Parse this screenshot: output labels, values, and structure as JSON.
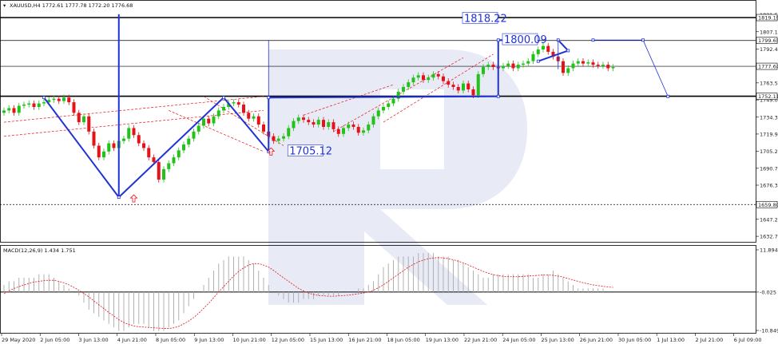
{
  "symbol_header": "XAUUSD,H4  1772.61 1777.78 1772.20 1776.68",
  "macd_header": "MACD(12,26,9) 1.434 1.751",
  "colors": {
    "background": "#ffffff",
    "bull_candle": "#22c21a",
    "bear_candle": "#e5121a",
    "level_line": "#000000",
    "pattern_line": "#1f33d6",
    "channel": "#e5121a",
    "macd_histogram": "#b0b0b0",
    "macd_signal": "#e5121a",
    "grid": "#c0c0c0",
    "watermark": "#e8ebf6"
  },
  "chart_data": {
    "type": "candlestick",
    "price_axis": {
      "ticks": [
        "1821.55",
        "1807.10",
        "1792.45",
        "1763.50",
        "1749.00",
        "1734.30",
        "1719.90",
        "1705.25",
        "1690.70",
        "1676.30",
        "1647.20",
        "1632.70"
      ],
      "highlighted_levels": [
        {
          "label": "1819.19",
          "value": 1819.19
        },
        {
          "label": "1799.65",
          "value": 1799.65
        },
        {
          "label": "1777.64",
          "value": 1777.64
        },
        {
          "label": "1752.11",
          "value": 1752.11
        },
        {
          "label": "1659.80",
          "value": 1659.8
        }
      ]
    },
    "time_axis": {
      "labels": [
        "29 May 2020",
        "2 Jun 05:00",
        "3 Jun 13:00",
        "4 Jun 21:00",
        "8 Jun 05:00",
        "9 Jun 13:00",
        "10 Jun 21:00",
        "12 Jun 05:00",
        "15 Jun 13:00",
        "16 Jun 21:00",
        "18 Jun 05:00",
        "19 Jun 13:00",
        "22 Jun 21:00",
        "24 Jun 05:00",
        "25 Jun 13:00",
        "26 Jun 21:00",
        "30 Jun 05:00",
        "1 Jul 13:00",
        "2 Jul 21:00",
        "6 Jul 09:00"
      ]
    },
    "candles_close": [
      1740,
      1742,
      1738,
      1744,
      1745,
      1746,
      1743,
      1746,
      1747,
      1749,
      1750,
      1748,
      1751,
      1747,
      1738,
      1730,
      1735,
      1722,
      1710,
      1700,
      1705,
      1712,
      1708,
      1714,
      1716,
      1725,
      1719,
      1712,
      1708,
      1700,
      1696,
      1681,
      1690,
      1695,
      1700,
      1706,
      1711,
      1716,
      1722,
      1727,
      1733,
      1729,
      1735,
      1740,
      1743,
      1746,
      1747,
      1745,
      1738,
      1733,
      1735,
      1728,
      1722,
      1718,
      1714,
      1716,
      1718,
      1725,
      1731,
      1734,
      1732,
      1730,
      1728,
      1732,
      1726,
      1730,
      1724,
      1720,
      1725,
      1728,
      1726,
      1721,
      1723,
      1728,
      1735,
      1740,
      1743,
      1746,
      1750,
      1756,
      1760,
      1764,
      1768,
      1770,
      1766,
      1768,
      1771,
      1769,
      1765,
      1762,
      1760,
      1757,
      1763,
      1758,
      1753,
      1771,
      1777,
      1779,
      1777,
      1776,
      1778,
      1780,
      1776,
      1779,
      1780,
      1782,
      1788,
      1792,
      1795,
      1790,
      1786,
      1782,
      1772,
      1776,
      1780,
      1782,
      1780,
      1781,
      1779,
      1778,
      1779,
      1776,
      1777
    ],
    "levels": [
      1819.19,
      1799.65,
      1777.64,
      1752.11,
      1659.8
    ],
    "annotations": [
      {
        "label": "1818.22",
        "value": 1818.22
      },
      {
        "label": "1800.09",
        "value": 1800.09
      },
      {
        "label": "1705.12",
        "value": 1705.12
      }
    ],
    "pattern_path": [
      {
        "bar": 8,
        "price": 1751
      },
      {
        "bar": 23,
        "price": 1666
      },
      {
        "bar": 44,
        "price": 1751
      },
      {
        "bar": 53,
        "price": 1705
      },
      {
        "bar": 53,
        "price": 1751
      },
      {
        "bar": 99,
        "price": 1752
      },
      {
        "bar": 99,
        "price": 1800
      },
      {
        "bar": 105,
        "price": 1800
      }
    ],
    "pattern_path_2": [
      {
        "bar": 107,
        "price": 1782
      },
      {
        "bar": 113,
        "price": 1791
      },
      {
        "bar": 111,
        "price": 1800
      }
    ],
    "spike": {
      "bar": 23,
      "price_top": 1822,
      "price_bottom": 1666
    },
    "forecast_path": [
      {
        "bar": 118,
        "price": 1800
      },
      {
        "bar": 128,
        "price": 1800
      },
      {
        "bar": 133,
        "price": 1752
      }
    ],
    "macd_axis": {
      "ticks": [
        "11.894",
        "-0.025",
        "-10.849"
      ],
      "ylim": [
        -10.849,
        11.894
      ]
    },
    "macd_histogram": [
      2,
      3,
      3,
      4,
      4,
      4,
      4,
      5,
      5,
      5,
      4,
      3,
      2,
      1,
      0,
      -1,
      -3,
      -5,
      -6,
      -7,
      -8,
      -9,
      -10,
      -11,
      -11,
      -10,
      -9,
      -9,
      -9,
      -10,
      -11,
      -11,
      -11,
      -10,
      -9,
      -8,
      -6,
      -4,
      -2,
      0,
      2,
      4,
      6,
      8,
      9,
      10,
      10,
      10,
      10,
      9,
      8,
      6,
      4,
      2,
      0,
      -1,
      -2,
      -3,
      -3,
      -3,
      -2,
      -2,
      -2,
      -1,
      -1,
      -1,
      -1,
      -1,
      0,
      0,
      0,
      1,
      1,
      2,
      3,
      5,
      7,
      8,
      9,
      10,
      10,
      10,
      10,
      11,
      11,
      11,
      11,
      10,
      10,
      10,
      9,
      9,
      8,
      7,
      6,
      5,
      4,
      4,
      5,
      5,
      5,
      5,
      5,
      5,
      5,
      5,
      4,
      4,
      5,
      5,
      6,
      5,
      4,
      3,
      2,
      1,
      1,
      1,
      1,
      1,
      1,
      0,
      0,
      0
    ],
    "macd_signal": [
      -0.5,
      0.3,
      1,
      1.5,
      2,
      2.4,
      2.8,
      3,
      3.2,
      3.3,
      3.3,
      3,
      2.6,
      2,
      1.3,
      0.5,
      -0.4,
      -1.4,
      -2.5,
      -3.6,
      -4.7,
      -5.8,
      -6.8,
      -7.8,
      -8.6,
      -9.2,
      -9.6,
      -9.8,
      -9.9,
      -10,
      -10.1,
      -10.2,
      -10.3,
      -10.3,
      -10.1,
      -9.7,
      -9,
      -8.2,
      -7.2,
      -6,
      -4.6,
      -3.2,
      -1.6,
      0,
      1.5,
      3,
      4.5,
      5.8,
      6.8,
      7.6,
      8,
      8,
      7.6,
      7,
      6.1,
      5,
      4,
      3,
      2,
      1,
      0.3,
      -0.3,
      -0.7,
      -1,
      -1.1,
      -1.2,
      -1.2,
      -1.1,
      -1,
      -0.9,
      -0.7,
      -0.5,
      -0.3,
      0,
      0.5,
      1.2,
      2,
      3,
      4,
      5,
      6,
      7,
      7.8,
      8.5,
      9,
      9.4,
      9.6,
      9.7,
      9.6,
      9.4,
      9.1,
      8.7,
      8.2,
      7.6,
      7,
      6.4,
      5.8,
      5.3,
      4.9,
      4.6,
      4.4,
      4.3,
      4.3,
      4.3,
      4.4,
      4.5,
      4.6,
      4.7,
      4.8,
      4.8,
      4.7,
      4.5,
      4.2,
      3.8,
      3.4,
      3,
      2.6,
      2.3,
      2,
      1.8,
      1.6,
      1.4,
      1.3
    ]
  }
}
